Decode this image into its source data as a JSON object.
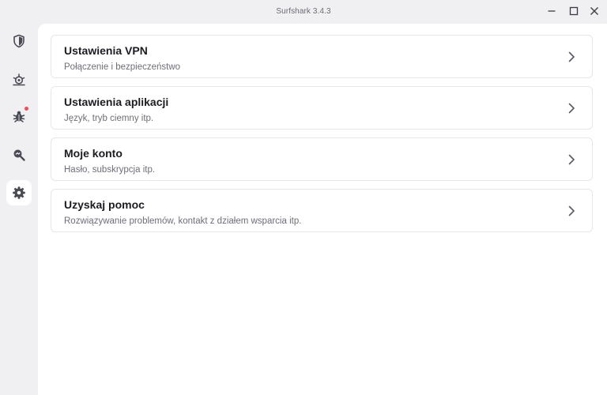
{
  "window": {
    "title": "Surfshark 3.4.3",
    "controls": [
      "minimize-icon",
      "maximize-icon",
      "close-icon"
    ]
  },
  "sidebar": {
    "items": [
      {
        "icon": "shield-icon",
        "active": false,
        "badge": false
      },
      {
        "icon": "virus-scan-icon",
        "active": false,
        "badge": false
      },
      {
        "icon": "bug-alert-icon",
        "active": false,
        "badge": true
      },
      {
        "icon": "search-alert-icon",
        "active": false,
        "badge": false
      },
      {
        "icon": "gear-icon",
        "active": true,
        "badge": false
      }
    ]
  },
  "settings": {
    "items": [
      {
        "title": "Ustawienia VPN",
        "subtitle": "Połączenie i bezpieczeństwo"
      },
      {
        "title": "Ustawienia aplikacji",
        "subtitle": "Język, tryb ciemny itp."
      },
      {
        "title": "Moje konto",
        "subtitle": "Hasło, subskrypcja itp."
      },
      {
        "title": "Uzyskaj pomoc",
        "subtitle": "Rozwiązywanie problemów, kontakt z działem wsparcia itp."
      }
    ]
  },
  "colors": {
    "background": "#f0f0f3",
    "panel": "#ffffff",
    "card_border": "#e6e6ea",
    "icon": "#4a4a55",
    "badge": "#f24c5a",
    "text_primary": "#1c1c22",
    "text_secondary": "#6e6e78"
  }
}
